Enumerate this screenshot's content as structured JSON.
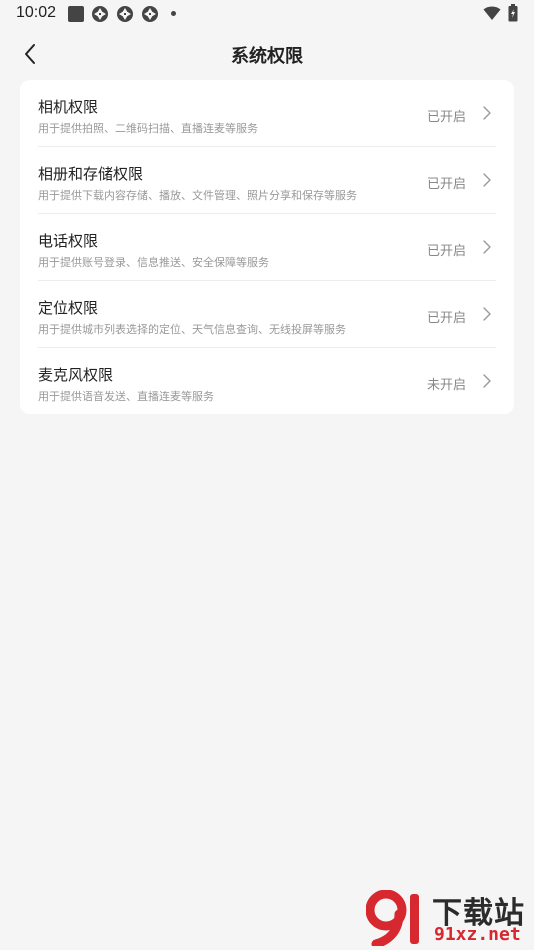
{
  "status_bar": {
    "time": "10:02"
  },
  "header": {
    "title": "系统权限"
  },
  "permissions": [
    {
      "title": "相机权限",
      "desc": "用于提供拍照、二维码扫描、直播连麦等服务",
      "status": "已开启"
    },
    {
      "title": "相册和存储权限",
      "desc": "用于提供下载内容存储、播放、文件管理、照片分享和保存等服务",
      "status": "已开启"
    },
    {
      "title": "电话权限",
      "desc": "用于提供账号登录、信息推送、安全保障等服务",
      "status": "已开启"
    },
    {
      "title": "定位权限",
      "desc": "用于提供城市列表选择的定位、天气信息查询、无线投屏等服务",
      "status": "已开启"
    },
    {
      "title": "麦克风权限",
      "desc": "用于提供语音发送、直播连麦等服务",
      "status": "未开启"
    }
  ],
  "watermark": {
    "brand": "下载站",
    "domain": "91xz.net"
  },
  "colors": {
    "background": "#f5f5f5",
    "card": "#ffffff",
    "watermark_red": "#d6282e"
  }
}
